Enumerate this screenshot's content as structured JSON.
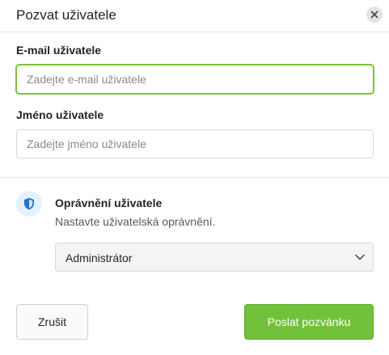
{
  "dialog": {
    "title": "Pozvat uživatele",
    "close_icon": "close-icon"
  },
  "email": {
    "label": "E-mail uživatele",
    "value": "",
    "placeholder": "Zadejte e-mail uživatele",
    "focused": true
  },
  "name": {
    "label": "Jméno uživatele",
    "value": "",
    "placeholder": "Zadejte jméno uživatele"
  },
  "permissions": {
    "icon": "shield-icon",
    "title": "Oprávnění uživatele",
    "description": "Nastavte uživatelská oprávnění.",
    "selected": "Administrátor"
  },
  "actions": {
    "cancel_label": "Zrušit",
    "submit_label": "Poslat pozvánku"
  },
  "colors": {
    "accent": "#72c13a",
    "focus_border": "#7cc23b",
    "shield": "#1e73c8",
    "shield_bg": "#e6f0fb"
  }
}
